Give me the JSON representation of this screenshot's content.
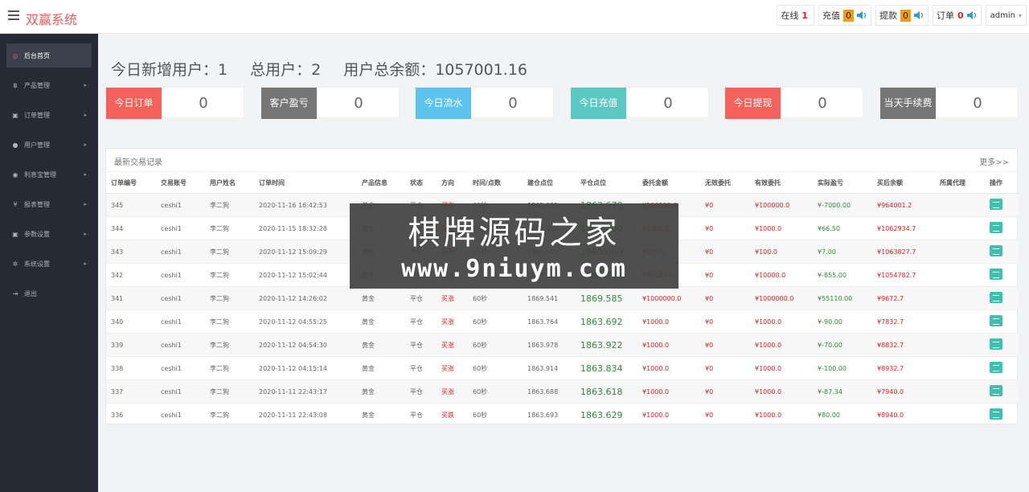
{
  "header": {
    "brand": "双赢系统",
    "online_label": "在线",
    "online_count": "1",
    "recharge_label": "充值",
    "recharge_count": "0",
    "withdraw_label": "提款",
    "withdraw_count": "0",
    "order_label": "订单",
    "order_count": "0",
    "user": "admin"
  },
  "sidebar": {
    "items": [
      {
        "label": "后台首页",
        "icon": "dashboard-icon",
        "glyph": "◎"
      },
      {
        "label": "产品管理",
        "icon": "bitcoin-icon",
        "glyph": "฿"
      },
      {
        "label": "订单管理",
        "icon": "copy-icon",
        "glyph": "▣"
      },
      {
        "label": "用户管理",
        "icon": "user-icon",
        "glyph": "●"
      },
      {
        "label": "利息宝管理",
        "icon": "target-icon",
        "glyph": "◉"
      },
      {
        "label": "报表管理",
        "icon": "yen-icon",
        "glyph": "¥"
      },
      {
        "label": "参数设置",
        "icon": "copy-icon",
        "glyph": "▣"
      },
      {
        "label": "系统设置",
        "icon": "gears-icon",
        "glyph": "✲"
      },
      {
        "label": "退出",
        "icon": "signout-icon",
        "glyph": "⇥"
      }
    ]
  },
  "stats": {
    "new_users": "今日新增用户：1",
    "total_users": "总用户：2",
    "balance": "用户总余额：1057001.16"
  },
  "cards": [
    {
      "line1": "今日",
      "line2": "订单",
      "value": "0",
      "color": "#f5625c"
    },
    {
      "line1": "客户",
      "line2": "盈亏",
      "value": "0",
      "color": "#767676"
    },
    {
      "line1": "今日",
      "line2": "流水",
      "value": "0",
      "color": "#5cc3ee"
    },
    {
      "line1": "今日",
      "line2": "充值",
      "value": "0",
      "color": "#5cc8c4"
    },
    {
      "line1": "今日",
      "line2": "提现",
      "value": "0",
      "color": "#f5625c"
    },
    {
      "line1": "当天",
      "line2": "手续费",
      "value": "0",
      "color": "#767676"
    }
  ],
  "trades": {
    "title": "最新交易记录",
    "more": "更多>>",
    "columns": [
      "订单编号",
      "交易账号",
      "用户姓名",
      "订单时间",
      "产品信息",
      "状态",
      "方向",
      "时间/点数",
      "建仓点位",
      "平仓点位",
      "委托金额",
      "无效委托",
      "有效委托",
      "实际盈亏",
      "买后余额",
      "所属代理",
      "操作"
    ],
    "rows": [
      [
        "345",
        "ceshi1",
        "李二狗",
        "2020-11-16 16:42:53",
        "黄金",
        "平仓",
        "买涨",
        "60秒",
        "1863.635",
        "1863.670",
        "¥100000.0",
        "¥0",
        "¥100000.0",
        "¥-7000.00",
        "¥964001.2",
        ""
      ],
      [
        "344",
        "ceshi1",
        "李二狗",
        "2020-11-15 18:32:28",
        "黄金",
        "平仓",
        "买涨",
        "60秒",
        "1863.000",
        "1863.000",
        "¥1000.0",
        "¥0",
        "¥1000.0",
        "¥66.50",
        "¥1062934.7",
        ""
      ],
      [
        "343",
        "ceshi1",
        "李二狗",
        "2020-11-12 15:09:29",
        "黄金",
        "平仓",
        "买涨",
        "60秒",
        "1863.000",
        "1863.000",
        "¥100.0",
        "¥0",
        "¥100.0",
        "¥7.00",
        "¥1063827.7",
        ""
      ],
      [
        "342",
        "ceshi1",
        "李二狗",
        "2020-11-12 15:02:44",
        "黄金",
        "平仓",
        "买涨",
        "60秒",
        "1863.000",
        "1863.000",
        "¥10000.0",
        "¥0",
        "¥10000.0",
        "¥-855.00",
        "¥1054782.7",
        ""
      ],
      [
        "341",
        "ceshi1",
        "李二狗",
        "2020-11-12 14:26:02",
        "黄金",
        "平仓",
        "买涨",
        "60秒",
        "1869.541",
        "1869.585",
        "¥1000000.0",
        "¥0",
        "¥1000000.0",
        "¥55110.00",
        "¥9672.7",
        ""
      ],
      [
        "340",
        "ceshi1",
        "李二狗",
        "2020-11-12 04:55:25",
        "黄金",
        "平仓",
        "买涨",
        "60秒",
        "1863.764",
        "1863.692",
        "¥1000.0",
        "¥0",
        "¥1000.0",
        "¥-90.00",
        "¥7832.7",
        ""
      ],
      [
        "339",
        "ceshi1",
        "李二狗",
        "2020-11-12 04:54:30",
        "黄金",
        "平仓",
        "买涨",
        "60秒",
        "1863.978",
        "1863.922",
        "¥1000.0",
        "¥0",
        "¥1000.0",
        "¥-70.00",
        "¥8832.7",
        ""
      ],
      [
        "338",
        "ceshi1",
        "李二狗",
        "2020-11-12 04:15:14",
        "黄金",
        "平仓",
        "买涨",
        "60秒",
        "1863.914",
        "1863.834",
        "¥1000.0",
        "¥0",
        "¥1000.0",
        "¥-100.00",
        "¥8932.7",
        ""
      ],
      [
        "337",
        "ceshi1",
        "李二狗",
        "2020-11-11 22:43:17",
        "黄金",
        "平仓",
        "买涨",
        "60秒",
        "1863.688",
        "1863.618",
        "¥1000.0",
        "¥0",
        "¥1000.0",
        "¥-87.34",
        "¥7940.0",
        ""
      ],
      [
        "336",
        "ceshi1",
        "李二狗",
        "2020-11-11 22:43:08",
        "黄金",
        "平仓",
        "买跌",
        "60秒",
        "1863.693",
        "1863.629",
        "¥1000.0",
        "¥0",
        "¥1000.0",
        "¥80.00",
        "¥8940.0",
        ""
      ]
    ]
  },
  "watermark": {
    "line1": "棋牌源码之家",
    "line2": "www.9niuym.com"
  },
  "colors": {
    "brand": "#f05a5a",
    "sidebar_bg": "#252a35",
    "op_button": "#3cc3b0",
    "loss_red": "#e02020",
    "profit_green": "#2e8b3a"
  }
}
